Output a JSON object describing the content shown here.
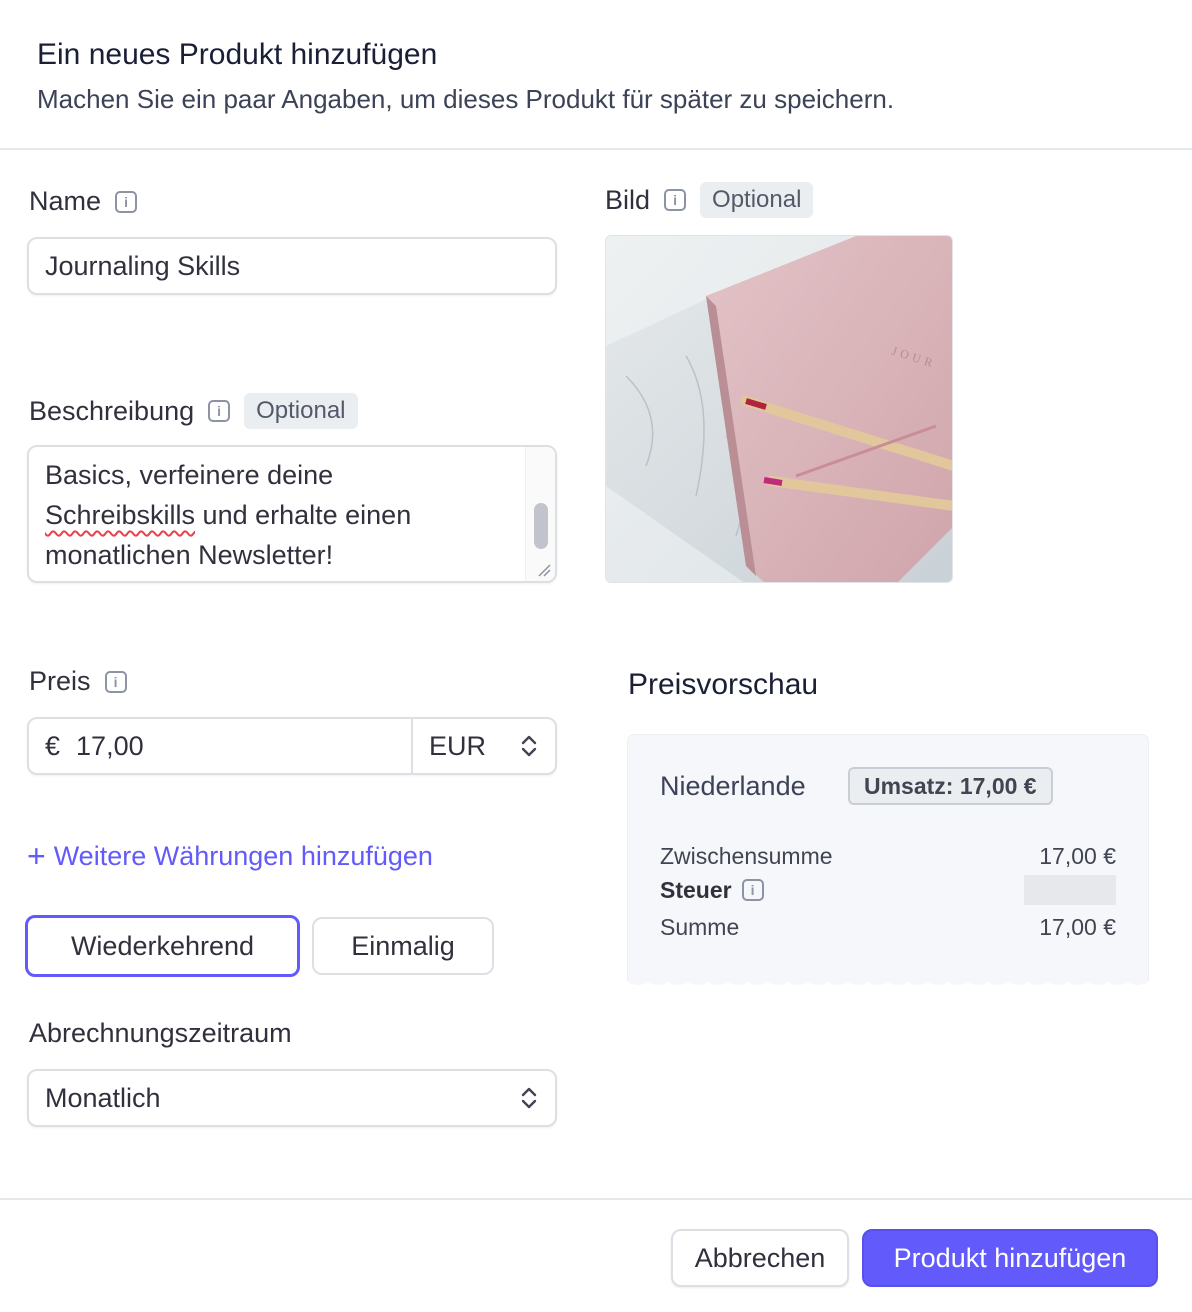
{
  "header": {
    "title": "Ein neues Produkt hinzufügen",
    "subtitle": "Machen Sie ein paar Angaben, um dieses Produkt für später zu speichern."
  },
  "name": {
    "label": "Name",
    "value": "Journaling Skills"
  },
  "description": {
    "label": "Beschreibung",
    "badge": "Optional",
    "line1": "Basics, verfeinere deine",
    "line2_word": "Schreibskills",
    "line2_rest": " und erhalte einen",
    "line3": "monatlichen Newsletter!"
  },
  "image": {
    "label": "Bild",
    "badge": "Optional",
    "notebook_text": "JOUR"
  },
  "price": {
    "label": "Preis",
    "symbol": "€",
    "amount": "17,00",
    "currency": "EUR"
  },
  "add_currency": {
    "plus": "+",
    "label": "Weitere Währungen hinzufügen"
  },
  "pricing_type": {
    "recurring": "Wiederkehrend",
    "one_time": "Einmalig",
    "selected": "recurring"
  },
  "billing_period": {
    "label": "Abrechnungszeitraum",
    "value": "Monatlich"
  },
  "preview": {
    "title": "Preisvorschau",
    "country": "Niederlande",
    "revenue_badge": "Umsatz: 17,00 €",
    "subtotal_label": "Zwischensumme",
    "subtotal_value": "17,00 €",
    "tax_label": "Steuer",
    "total_label": "Summe",
    "total_value": "17,00 €"
  },
  "footer": {
    "cancel": "Abbrechen",
    "submit": "Produkt hinzufügen"
  },
  "colors": {
    "accent": "#625afa",
    "text": "#1a1f36",
    "border": "#dcdfe4"
  }
}
